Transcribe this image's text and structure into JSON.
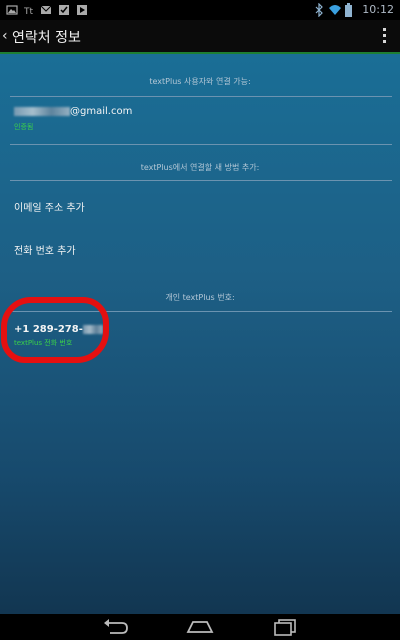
{
  "status_bar": {
    "time": "10:12",
    "left_icons": [
      "image-icon",
      "tt-icon",
      "mail-icon",
      "check-icon",
      "play-icon"
    ],
    "right_icons": [
      "bluetooth-icon",
      "wifi-icon",
      "battery-icon"
    ]
  },
  "action_bar": {
    "title": "연락처 정보",
    "back_icon": "‹"
  },
  "sections": {
    "textplus_users_header": "textPlus 사용자와 연결 가능:",
    "email": {
      "suffix": "@gmail.com",
      "sublabel": "인증됨"
    },
    "add_connection_header": "textPlus에서 연결할 새 방법 추가:",
    "add_email": "이메일 주소 추가",
    "add_phone": "전화 번호 추가",
    "private_number_header": "개인 textPlus 번호:",
    "phone": {
      "number": "+1 289-278-",
      "sublabel": "textPlus 전화 번호"
    }
  },
  "nav_bar": {
    "buttons": [
      "back-nav-icon",
      "home-nav-icon",
      "recents-nav-icon"
    ]
  },
  "colors": {
    "accent_green": "#3bd04a",
    "annotation_red": "#e51010",
    "action_bar_line": "#1e7f33"
  }
}
